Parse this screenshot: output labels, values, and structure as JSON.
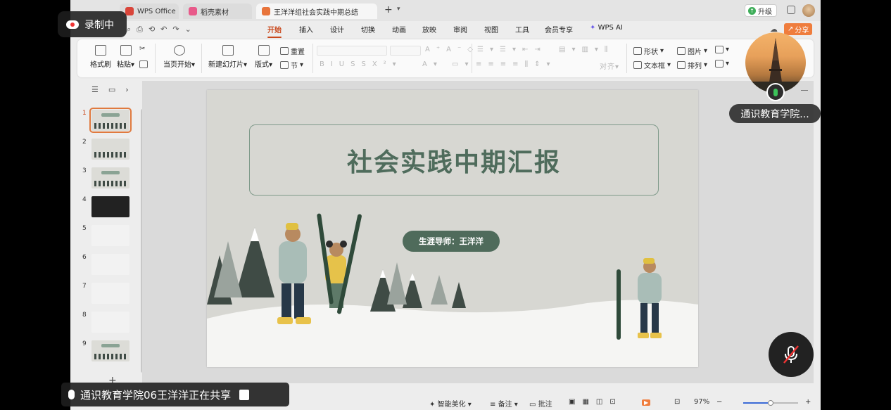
{
  "recording": {
    "label": "录制中"
  },
  "titlebar": {
    "tabs": [
      {
        "label": "WPS Office",
        "color": "#d9453a"
      },
      {
        "label": "稻壳素材",
        "color": "#e85a8a"
      },
      {
        "label": "王洋洋组社会实践中期总结",
        "color": "#e8743b"
      }
    ],
    "upgrade_label": "升级"
  },
  "ribbon": {
    "tabs": [
      "开始",
      "插入",
      "设计",
      "切换",
      "动画",
      "放映",
      "审阅",
      "视图",
      "工具",
      "会员专享",
      "WPS AI"
    ],
    "active_tab": "开始",
    "share_label": "分享"
  },
  "toolbar": {
    "format_painter": "格式刷",
    "paste": "粘贴",
    "from_current": "当页开始",
    "new_slide": "新建幻灯片",
    "layout": "版式",
    "reset": "重置",
    "section": "节",
    "shape": "形状",
    "picture": "图片",
    "textbox": "文本框",
    "arrange": "排列",
    "align": "对齐"
  },
  "slides_panel": {
    "numbers": [
      "1",
      "2",
      "3",
      "4",
      "5",
      "6",
      "7",
      "8",
      "9"
    ],
    "selected": "1"
  },
  "slide": {
    "title": "社会实践中期汇报",
    "subtitle": "生涯导师：王洋洋"
  },
  "statusbar": {
    "smart_beautify": "智能美化",
    "notes": "备注",
    "comments": "批注",
    "zoom": "97%",
    "zoom_fraction": 0.5
  },
  "meeting": {
    "participant_name": "通识教育学院...",
    "share_banner": "通识教育学院06王洋洋正在共享"
  },
  "colors": {
    "accent": "#c9481c",
    "slide_green": "#4f6b5b",
    "share_orange": "#ef7d3d"
  }
}
